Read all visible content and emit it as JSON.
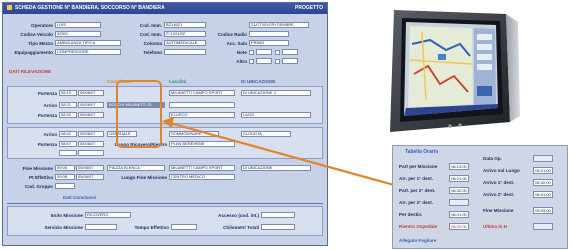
{
  "window": {
    "title": "SCHEDA GESTIONE N° BANDIERA, SOCCORSO N° BANDIERA",
    "title_right": "PROGETTO",
    "top_left": [
      {
        "label": "Operatore",
        "value": "LUIS"
      },
      {
        "label": "Codice Veicolo",
        "value": "52501"
      },
      {
        "label": "Tipo Mezzo",
        "value": "AMBULANZA TIPO A"
      },
      {
        "label": "Equipaggiamento",
        "value": "COMPRESSORE"
      }
    ],
    "top_mid": [
      {
        "label": "Cod. Imm.",
        "value": "BZ14621"
      },
      {
        "label": "Cod. Imm.",
        "value": "FI 1201/02"
      },
      {
        "label": "Colonna",
        "value": "AUTOMEDICALE"
      },
      {
        "label": "Telefono",
        "value": ""
      }
    ],
    "top_right": [
      {
        "label": "",
        "value": "21/CT/00/CRYSEMBRE"
      },
      {
        "label": "Codice Radio",
        "value": ""
      },
      {
        "label": "Acc. Sala",
        "value": "PRIMO"
      },
      {
        "label": "Note",
        "value": ""
      },
      {
        "label": "Altro",
        "value": ""
      }
    ],
    "section_red": "DATI RILEVAZIONE",
    "col_headers": {
      "orange": "Coordinate",
      "teal": "Località",
      "blue": "DI UBICAZIONE"
    },
    "rows_group1": [
      {
        "label": "Partenza",
        "time": "08:13",
        "date": "05/06/07",
        "loc": "MILANETTI CAMPO SPORT",
        "loc2": "DI UBICAZIONE C"
      },
      {
        "label": "Arrivo",
        "time": "08:21",
        "date": "05/06/07",
        "loc": "BOSCHI MILANETTI DI",
        "loc2": ""
      },
      {
        "label": "Partenza",
        "time": "08:32",
        "date": "05/06/07",
        "loc": "ELUSCO",
        "loc2": "LAGO"
      }
    ],
    "rows_group2": [
      {
        "label": "Arrivo",
        "time": "08:41",
        "date": "05/06/07",
        "loc": "OSPEDALE",
        "loc2": "SOMMODINARE",
        "loc3": "CLOUDTA"
      },
      {
        "label": "Partenza",
        "time": "08:57",
        "date": "05/06/07",
        "loc": "",
        "loc2": "Luogo Ricovero/Rientro",
        "loc3": "PLAN BEREHENE"
      },
      {
        "label": "",
        "time": "",
        "date": "",
        "loc": "",
        "loc2": "",
        "loc3": ""
      }
    ],
    "bottom_rows": [
      {
        "label": "Fine Missione",
        "v1": "09:05",
        "v2": "05/06/07",
        "mid": "PIAZZA ELENCA",
        "mid_label": "",
        "right": "MILANETTI CAMPO SPORT",
        "right2": "DI UBICAZIONE"
      },
      {
        "label": "Pt Effettiva",
        "v1": "09:08",
        "v2": "05/06/07",
        "mid": "",
        "mid_label": "Luogo Fine Missione",
        "right": "CENTRO MEDICO",
        "right2": ""
      },
      {
        "label": "Cod. Gruppo",
        "v1": "",
        "v2": "",
        "mid": "",
        "mid_label": "",
        "right": "",
        "right2": ""
      }
    ],
    "section_blue": "Dati Conclusivi",
    "concl": {
      "esito_label": "Esito Missione",
      "esito_value": "RICOVERO",
      "servizio_label": "Servizio Missione",
      "servizio_value": "",
      "tempo_label": "Tempo Effettivo",
      "tempo_value": "",
      "accesso_label": "Accesso (cod. int.)",
      "accesso_value": "",
      "chilometri_label": "Chilometri Totali",
      "chilometri_value": ""
    }
  },
  "inset": {
    "title": "Tabella Orario",
    "left_rows": [
      {
        "label": "Part per Missione",
        "value": "08:13:00",
        "red": false
      },
      {
        "label": "Arr. per 1° dest.",
        "value": "08:21:00",
        "red": false
      },
      {
        "label": "Part. per 2° dest.",
        "value": "08:32:00",
        "red": false
      },
      {
        "label": "Arr. per 2° dest.",
        "value": "",
        "red": false
      },
      {
        "label": "Per destin.",
        "value": "08:41:00",
        "red": false
      },
      {
        "label": "Rientro Ospedale",
        "value": "08:00:00",
        "red": true
      }
    ],
    "right_rows": [
      {
        "label": "Data Op.",
        "value": "",
        "red": false
      },
      {
        "label": "Arrivo sul Luogo",
        "value": "08:21:00",
        "red": false
      },
      {
        "label": "Arrivo 1° dest.",
        "value": "08:32:00",
        "red": false
      },
      {
        "label": "Arrivo 2° dest.",
        "value": "08:41:00",
        "red": false
      },
      {
        "label": "Fine Missione",
        "value": "09:05:00",
        "red": false
      },
      {
        "label": "Ultima in H",
        "value": "",
        "red": true
      }
    ],
    "footer": "Allegato Fogliare"
  },
  "colors": {
    "accent_orange": "#e0852a",
    "title_blue": "#2d4590",
    "form_bg": "#c7d2e8"
  },
  "icons": {
    "device": "tablet-device",
    "map": "map-screen"
  }
}
